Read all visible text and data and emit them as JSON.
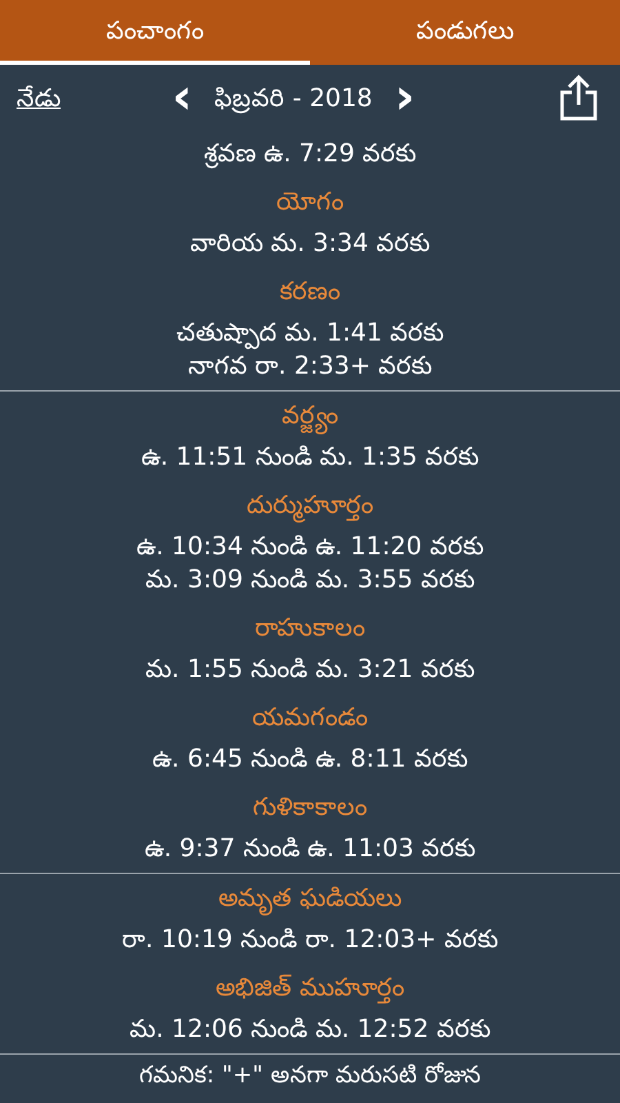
{
  "tabs": [
    {
      "label": "పంచాంగం",
      "selected": true
    },
    {
      "label": "పండుగలు",
      "selected": false
    }
  ],
  "nav": {
    "today": "నేడు",
    "prev": "‹",
    "month": "ఫిబ్రవరి - 2018",
    "next": "›"
  },
  "groups": [
    {
      "sections": [
        {
          "lines": [
            "శ్రవణ ఉ. 7:29 వరకు"
          ]
        },
        {
          "heading": "యోగం",
          "lines": [
            "వారియ మ. 3:34 వరకు"
          ]
        },
        {
          "heading": "కరణం",
          "lines": [
            "చతుష్పాద మ. 1:41 వరకు",
            "నాగవ రా. 2:33+ వరకు"
          ]
        }
      ]
    },
    {
      "sections": [
        {
          "heading": "వర్జ్యం",
          "lines": [
            "ఉ. 11:51 నుండి మ. 1:35 వరకు"
          ]
        },
        {
          "heading": "దుర్ముహూర్తం",
          "lines": [
            "ఉ. 10:34 నుండి ఉ. 11:20 వరకు",
            "మ. 3:09 నుండి మ. 3:55 వరకు"
          ]
        },
        {
          "heading": "రాహుకాలం",
          "lines": [
            "మ. 1:55 నుండి మ. 3:21 వరకు"
          ]
        },
        {
          "heading": "యమగండం",
          "lines": [
            "ఉ. 6:45 నుండి ఉ. 8:11 వరకు"
          ]
        },
        {
          "heading": "గుళికాకాలం",
          "lines": [
            "ఉ. 9:37 నుండి ఉ. 11:03 వరకు"
          ]
        }
      ]
    },
    {
      "sections": [
        {
          "heading": "అమృత ఘడియలు",
          "lines": [
            "రా. 10:19 నుండి రా. 12:03+ వరకు"
          ]
        },
        {
          "heading": "అభిజిత్ ముహూర్తం",
          "lines": [
            "మ. 12:06 నుండి మ. 12:52 వరకు"
          ]
        }
      ]
    }
  ],
  "note": "గమనిక: \"+\" అనగా మరుసటి రోజున"
}
